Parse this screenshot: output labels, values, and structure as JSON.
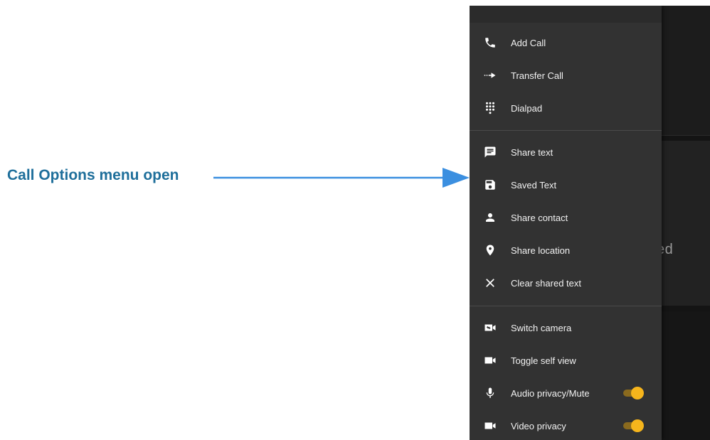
{
  "callout": {
    "text": "Call Options menu open"
  },
  "background": {
    "partial_text": "led"
  },
  "menu": {
    "items": [
      {
        "label": "Add Call",
        "icon": "phone-icon"
      },
      {
        "label": "Transfer Call",
        "icon": "transfer-icon"
      },
      {
        "label": "Dialpad",
        "icon": "dialpad-icon"
      },
      {
        "label": "Share text",
        "icon": "message-icon"
      },
      {
        "label": "Saved Text",
        "icon": "save-icon"
      },
      {
        "label": "Share contact",
        "icon": "person-icon"
      },
      {
        "label": "Share location",
        "icon": "location-pin-icon"
      },
      {
        "label": "Clear shared text",
        "icon": "close-icon"
      },
      {
        "label": "Switch camera",
        "icon": "switch-camera-icon"
      },
      {
        "label": "Toggle self view",
        "icon": "video-camera-icon"
      },
      {
        "label": "Audio privacy/Mute",
        "icon": "microphone-icon",
        "toggle_on": true
      },
      {
        "label": "Video privacy",
        "icon": "video-camera-icon",
        "toggle_on": true
      }
    ]
  },
  "colors": {
    "callout": "#1f6f9b",
    "menu_bg": "#323232",
    "toggle_on": "#f6b51c"
  }
}
